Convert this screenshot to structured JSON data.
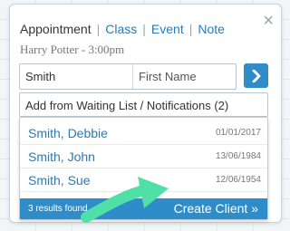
{
  "tabs": [
    {
      "label": "Appointment",
      "active": true
    },
    {
      "label": "Class",
      "active": false
    },
    {
      "label": "Event",
      "active": false
    },
    {
      "label": "Note",
      "active": false
    }
  ],
  "close_glyph": "×",
  "appointment_line": "Harry Potter - 3:00pm",
  "search": {
    "last_name_value": "Smith",
    "first_name_placeholder": "First Name"
  },
  "waiting_list_label": "Add from Waiting List / Notifications (2)",
  "results": [
    {
      "name": "Smith, Debbie",
      "dob": "01/01/2017"
    },
    {
      "name": "Smith, John",
      "dob": "13/06/1984"
    },
    {
      "name": "Smith, Sue",
      "dob": "12/06/1954"
    }
  ],
  "footer": {
    "count_label": "3 results found",
    "create_label": "Create Client »"
  },
  "colors": {
    "accent": "#2e8dc8",
    "link": "#2a7bb5",
    "highlight_arrow": "#4fe0a8"
  },
  "icons": {
    "go": "chevron-right-icon",
    "close": "close-icon",
    "pointer": "curved-arrow-icon"
  }
}
